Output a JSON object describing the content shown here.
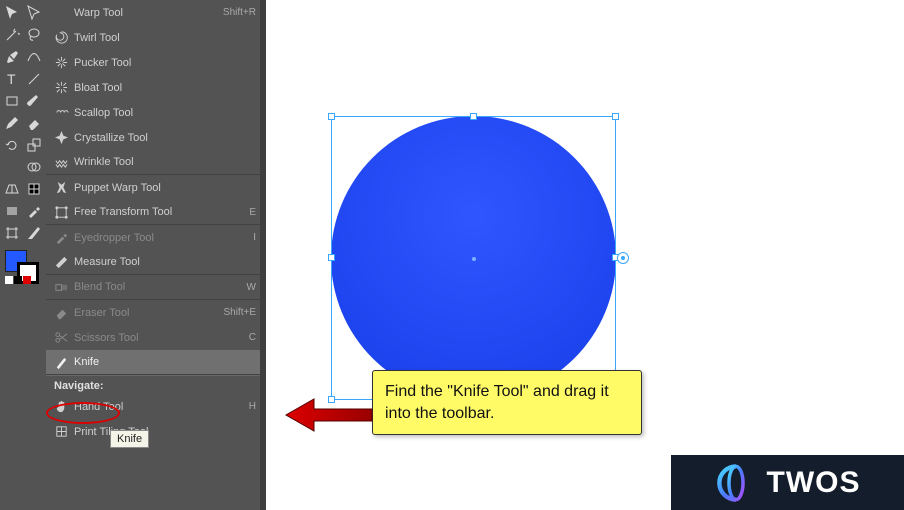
{
  "colors": {
    "panel_bg": "#535353",
    "selected_bg": "#707070",
    "circle_fill": "#2052f6",
    "selection_stroke": "#3aa7ff",
    "callout_bg": "#fffb66",
    "annotation_red": "#d00000",
    "twos_bg": "#141d2b"
  },
  "toolbar_icons": [
    "selection-tool",
    "direct-select-tool",
    "magic-wand-tool",
    "lasso-tool",
    "pen-tool",
    "curvature-tool",
    "type-tool",
    "line-tool",
    "rectangle-tool",
    "paintbrush-tool",
    "pencil-tool",
    "eraser-tool",
    "rotate-tool",
    "scale-tool",
    "width-tool",
    "shape-builder-tool",
    "perspective-tool",
    "mesh-tool",
    "gradient-tool",
    "eyedropper-tool",
    "blend-tool",
    "symbol-sprayer-tool",
    "column-graph-tool",
    "artboard-tool",
    "slice-tool",
    "hand-tool",
    "zoom-tool"
  ],
  "tools": [
    {
      "name": "Warp Tool",
      "shortcut": "Shift+R",
      "icon": "warp-icon",
      "group_end": false
    },
    {
      "name": "Twirl Tool",
      "shortcut": "",
      "icon": "twirl-icon",
      "group_end": false
    },
    {
      "name": "Pucker Tool",
      "shortcut": "",
      "icon": "pucker-icon",
      "group_end": false
    },
    {
      "name": "Bloat Tool",
      "shortcut": "",
      "icon": "bloat-icon",
      "group_end": false
    },
    {
      "name": "Scallop Tool",
      "shortcut": "",
      "icon": "scallop-icon",
      "group_end": false
    },
    {
      "name": "Crystallize Tool",
      "shortcut": "",
      "icon": "crystallize-icon",
      "group_end": false
    },
    {
      "name": "Wrinkle Tool",
      "shortcut": "",
      "icon": "wrinkle-icon",
      "group_end": true
    },
    {
      "name": "Puppet Warp Tool",
      "shortcut": "",
      "icon": "puppet-icon",
      "group_end": false
    },
    {
      "name": "Free Transform Tool",
      "shortcut": "E",
      "icon": "transform-icon",
      "group_end": true
    },
    {
      "name": "Eyedropper Tool",
      "shortcut": "I",
      "icon": "eyedropper-icon",
      "group_end": false,
      "dim": true
    },
    {
      "name": "Measure Tool",
      "shortcut": "",
      "icon": "measure-icon",
      "group_end": true
    },
    {
      "name": "Blend Tool",
      "shortcut": "W",
      "icon": "blend-icon",
      "group_end": true,
      "dim": true
    },
    {
      "name": "Eraser Tool",
      "shortcut": "Shift+E",
      "icon": "eraser-icon",
      "group_end": false,
      "dim": true
    },
    {
      "name": "Scissors Tool",
      "shortcut": "C",
      "icon": "scissors-icon",
      "group_end": false,
      "dim": true
    },
    {
      "name": "Knife",
      "shortcut": "",
      "icon": "knife-icon",
      "group_end": true,
      "selected": true
    }
  ],
  "tooltip_text": "Knife",
  "navigate_label": "Navigate:",
  "nav_items": [
    {
      "name": "Hand Tool",
      "shortcut": "H",
      "icon": "hand-icon"
    },
    {
      "name": "Print Tiling Tool",
      "shortcut": "",
      "icon": "print-tiling-icon"
    }
  ],
  "callout_text": "Find the \"Knife Tool\" and drag it into the toolbar.",
  "brand": {
    "name": "TWOS"
  }
}
